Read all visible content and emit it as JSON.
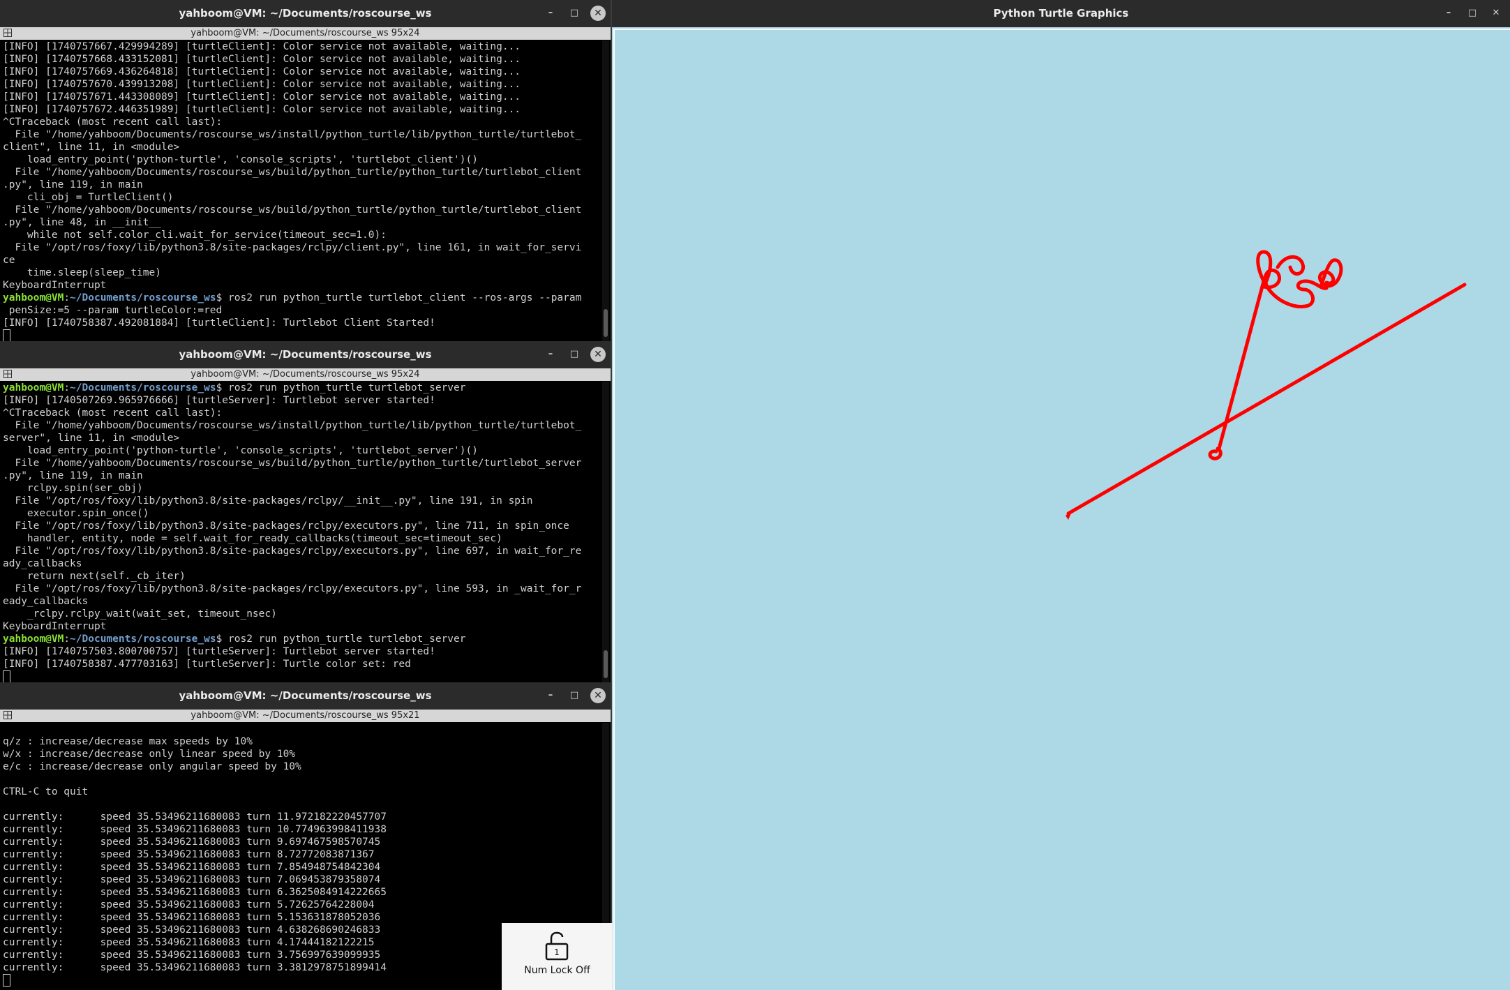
{
  "windows": [
    {
      "title": "yahboom@VM: ~/Documents/roscourse_ws",
      "tab_title": "yahboom@VM: ~/Documents/roscourse_ws 95x24",
      "lines": [
        "[INFO] [1740757667.429994289] [turtleClient]: Color service not available, waiting...",
        "[INFO] [1740757668.433152081] [turtleClient]: Color service not available, waiting...",
        "[INFO] [1740757669.436264818] [turtleClient]: Color service not available, waiting...",
        "[INFO] [1740757670.439913208] [turtleClient]: Color service not available, waiting...",
        "[INFO] [1740757671.443308089] [turtleClient]: Color service not available, waiting...",
        "[INFO] [1740757672.446351989] [turtleClient]: Color service not available, waiting...",
        "^CTraceback (most recent call last):",
        "  File \"/home/yahboom/Documents/roscourse_ws/install/python_turtle/lib/python_turtle/turtlebot_",
        "client\", line 11, in <module>",
        "    load_entry_point('python-turtle', 'console_scripts', 'turtlebot_client')()",
        "  File \"/home/yahboom/Documents/roscourse_ws/build/python_turtle/python_turtle/turtlebot_client",
        ".py\", line 119, in main",
        "    cli_obj = TurtleClient()",
        "  File \"/home/yahboom/Documents/roscourse_ws/build/python_turtle/python_turtle/turtlebot_client",
        ".py\", line 48, in __init__",
        "    while not self.color_cli.wait_for_service(timeout_sec=1.0):",
        "  File \"/opt/ros/foxy/lib/python3.8/site-packages/rclpy/client.py\", line 161, in wait_for_servi",
        "ce",
        "    time.sleep(sleep_time)",
        "KeyboardInterrupt",
        {
          "user": "yahboom@VM",
          "path": "~/Documents/roscourse_ws",
          "cmd": "$ ros2 run python_turtle turtlebot_client --ros-args --param"
        },
        " penSize:=5 --param turtleColor:=red",
        "[INFO] [1740758387.492081884] [turtleClient]: Turtlebot Client Started!"
      ]
    },
    {
      "title": "yahboom@VM: ~/Documents/roscourse_ws",
      "tab_title": "yahboom@VM: ~/Documents/roscourse_ws 95x24",
      "lines": [
        {
          "user": "yahboom@VM",
          "path": "~/Documents/roscourse_ws",
          "cmd": "$ ros2 run python_turtle turtlebot_server"
        },
        "[INFO] [1740507269.965976666] [turtleServer]: Turtlebot server started!",
        "^CTraceback (most recent call last):",
        "  File \"/home/yahboom/Documents/roscourse_ws/install/python_turtle/lib/python_turtle/turtlebot_",
        "server\", line 11, in <module>",
        "    load_entry_point('python-turtle', 'console_scripts', 'turtlebot_server')()",
        "  File \"/home/yahboom/Documents/roscourse_ws/build/python_turtle/python_turtle/turtlebot_server",
        ".py\", line 119, in main",
        "    rclpy.spin(ser_obj)",
        "  File \"/opt/ros/foxy/lib/python3.8/site-packages/rclpy/__init__.py\", line 191, in spin",
        "    executor.spin_once()",
        "  File \"/opt/ros/foxy/lib/python3.8/site-packages/rclpy/executors.py\", line 711, in spin_once",
        "    handler, entity, node = self.wait_for_ready_callbacks(timeout_sec=timeout_sec)",
        "  File \"/opt/ros/foxy/lib/python3.8/site-packages/rclpy/executors.py\", line 697, in wait_for_re",
        "ady_callbacks",
        "    return next(self._cb_iter)",
        "  File \"/opt/ros/foxy/lib/python3.8/site-packages/rclpy/executors.py\", line 593, in _wait_for_r",
        "eady_callbacks",
        "    _rclpy.rclpy_wait(wait_set, timeout_nsec)",
        "KeyboardInterrupt",
        {
          "user": "yahboom@VM",
          "path": "~/Documents/roscourse_ws",
          "cmd": "$ ros2 run python_turtle turtlebot_server"
        },
        "[INFO] [1740757503.800700757] [turtleServer]: Turtlebot server started!",
        "[INFO] [1740758387.477703163] [turtleServer]: Turtle color set: red"
      ]
    },
    {
      "title": "yahboom@VM: ~/Documents/roscourse_ws",
      "tab_title": "yahboom@VM: ~/Documents/roscourse_ws 95x21",
      "lines": [
        "",
        "q/z : increase/decrease max speeds by 10%",
        "w/x : increase/decrease only linear speed by 10%",
        "e/c : increase/decrease only angular speed by 10%",
        "",
        "CTRL-C to quit",
        "",
        "currently:      speed 35.53496211680083 turn 11.972182220457707",
        "currently:      speed 35.53496211680083 turn 10.774963998411938",
        "currently:      speed 35.53496211680083 turn 9.697467598570745",
        "currently:      speed 35.53496211680083 turn 8.72772083871367",
        "currently:      speed 35.53496211680083 turn 7.854948754842304",
        "currently:      speed 35.53496211680083 turn 7.069453879358074",
        "currently:      speed 35.53496211680083 turn 6.3625084914222665",
        "currently:      speed 35.53496211680083 turn 5.72625764228004",
        "currently:      speed 35.53496211680083 turn 5.153631878052036",
        "currently:      speed 35.53496211680083 turn 4.638268690246833",
        "currently:      speed 35.53496211680083 turn 4.17444182122215",
        "currently:      speed 35.53496211680083 turn 3.756997639099935",
        "currently:      speed 35.53496211680083 turn 3.3812978751899414"
      ]
    }
  ],
  "turtle_window": {
    "title": "Python Turtle Graphics",
    "pen_color": "#ff0000",
    "background": "#add8e6"
  },
  "window_controls": {
    "minimize": "–",
    "maximize": "□",
    "close": "✕"
  },
  "numlock": {
    "label": "Num Lock Off",
    "key": "1"
  },
  "colors": {
    "prompt_user": "#8ae234",
    "prompt_path": "#729fcf",
    "terminal_bg": "#000000",
    "terminal_fg": "#d0d0d0"
  }
}
